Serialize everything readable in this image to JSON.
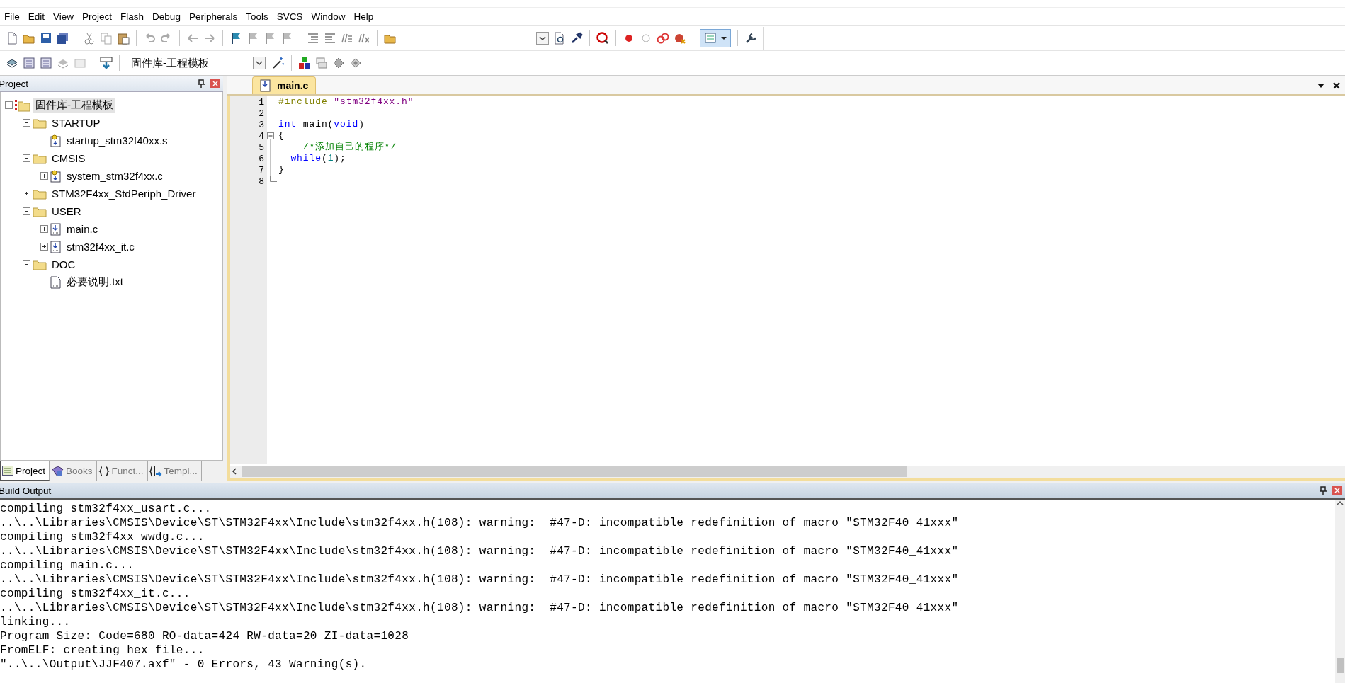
{
  "menu": [
    "File",
    "Edit",
    "View",
    "Project",
    "Flash",
    "Debug",
    "Peripherals",
    "Tools",
    "SVCS",
    "Window",
    "Help"
  ],
  "toolbar": {
    "target_select": {
      "value": "固件库-工程模板"
    }
  },
  "project_panel": {
    "title": "Project",
    "tree": [
      {
        "label": "固件库-工程模板",
        "kind": "project",
        "expanded": true,
        "selected": true,
        "children": [
          {
            "label": "STARTUP",
            "kind": "folder",
            "expanded": true,
            "selected": false,
            "children": [
              {
                "label": "startup_stm32f40xx.s",
                "kind": "config-file",
                "selected": false
              }
            ]
          },
          {
            "label": "CMSIS",
            "kind": "folder",
            "expanded": true,
            "selected": false,
            "children": [
              {
                "label": "system_stm32f4xx.c",
                "kind": "config-file",
                "expanded": false,
                "selected": false
              }
            ]
          },
          {
            "label": "STM32F4xx_StdPeriph_Driver",
            "kind": "folder",
            "expanded": false,
            "selected": false
          },
          {
            "label": "USER",
            "kind": "folder",
            "expanded": true,
            "selected": false,
            "children": [
              {
                "label": "main.c",
                "kind": "source-file",
                "expanded": false,
                "selected": false
              },
              {
                "label": "stm32f4xx_it.c",
                "kind": "source-file",
                "expanded": false,
                "selected": false
              }
            ]
          },
          {
            "label": "DOC",
            "kind": "folder",
            "expanded": true,
            "selected": false,
            "children": [
              {
                "label": "必要说明.txt",
                "kind": "text-file",
                "selected": false
              }
            ]
          }
        ]
      }
    ],
    "tabs": [
      {
        "label": "Project",
        "kind": "project",
        "selected": true
      },
      {
        "label": "Books",
        "kind": "books",
        "selected": false
      },
      {
        "label": "Funct...",
        "kind": "functions",
        "selected": false
      },
      {
        "label": "Templ...",
        "kind": "templates",
        "selected": false
      }
    ]
  },
  "editor": {
    "tabs": [
      {
        "label": "main.c",
        "selected": true
      }
    ],
    "lines": [
      {
        "number": "1",
        "fold_start": false,
        "in_fold": false,
        "tokens": [
          {
            "text": "#include ",
            "kind": "preprocessor"
          },
          {
            "text": "\"stm32f4xx.h\"",
            "kind": "string"
          }
        ]
      },
      {
        "number": "2",
        "fold_start": false,
        "in_fold": false
      },
      {
        "number": "3",
        "fold_start": false,
        "in_fold": false,
        "tokens": [
          {
            "text": "int",
            "kind": "keyword"
          },
          {
            "text": " main(",
            "kind": "plain"
          },
          {
            "text": "void",
            "kind": "keyword"
          },
          {
            "text": ")",
            "kind": "plain"
          }
        ]
      },
      {
        "number": "4",
        "fold_start": true,
        "in_fold": false,
        "tokens": [
          {
            "text": "{",
            "kind": "plain"
          }
        ]
      },
      {
        "number": "5",
        "fold_start": false,
        "in_fold": true,
        "tokens": [
          {
            "text": "    /*添加自己的程序*/",
            "kind": "comment"
          }
        ]
      },
      {
        "number": "6",
        "fold_start": false,
        "in_fold": true,
        "tokens": [
          {
            "text": "  while",
            "kind": "keyword"
          },
          {
            "text": "(",
            "kind": "plain"
          },
          {
            "text": "1",
            "kind": "number"
          },
          {
            "text": ");",
            "kind": "plain"
          }
        ]
      },
      {
        "number": "7",
        "fold_start": false,
        "in_fold": true,
        "tokens": [
          {
            "text": "}",
            "kind": "plain"
          }
        ]
      },
      {
        "number": "8",
        "fold_start": false,
        "in_fold": true
      }
    ]
  },
  "build_output": {
    "title": "Build Output",
    "lines": [
      "compiling stm32f4xx_usart.c...",
      "..\\..\\Libraries\\CMSIS\\Device\\ST\\STM32F4xx\\Include\\stm32f4xx.h(108): warning:  #47-D: incompatible redefinition of macro \"STM32F40_41xxx\"",
      "compiling stm32f4xx_wwdg.c...",
      "..\\..\\Libraries\\CMSIS\\Device\\ST\\STM32F4xx\\Include\\stm32f4xx.h(108): warning:  #47-D: incompatible redefinition of macro \"STM32F40_41xxx\"",
      "compiling main.c...",
      "..\\..\\Libraries\\CMSIS\\Device\\ST\\STM32F4xx\\Include\\stm32f4xx.h(108): warning:  #47-D: incompatible redefinition of macro \"STM32F40_41xxx\"",
      "compiling stm32f4xx_it.c...",
      "..\\..\\Libraries\\CMSIS\\Device\\ST\\STM32F4xx\\Include\\stm32f4xx.h(108): warning:  #47-D: incompatible redefinition of macro \"STM32F40_41xxx\"",
      "linking...",
      "Program Size: Code=680 RO-data=424 RW-data=20 ZI-data=1028",
      "FromELF: creating hex file...",
      "\"..\\..\\Output\\JJF407.axf\" - 0 Errors, 43 Warning(s)."
    ]
  }
}
